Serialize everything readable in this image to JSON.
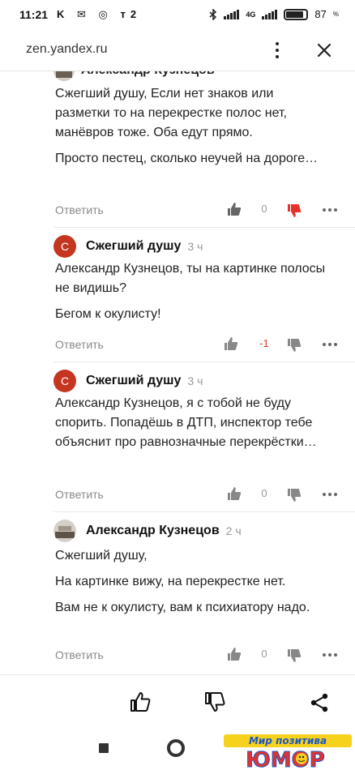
{
  "status_bar": {
    "time": "11:21",
    "left_icons": "K ✉ ◎ т2",
    "network": "4G",
    "battery_label": "87",
    "battery_percent": 87
  },
  "browser": {
    "url": "zen.yandex.ru"
  },
  "clipped_comment": {
    "author": "Александр Кузнецов",
    "paragraphs": [
      "Сжегший душу, Если нет знаков или разметки то на перекрестке полос нет, манёвров тоже. Оба едут прямо.",
      "Просто пестец, сколько неучей на дороге…"
    ],
    "reply_label": "Ответить",
    "score": "0",
    "user_vote": "dislike"
  },
  "comments": [
    {
      "avatar_letter": "С",
      "author": "Сжегший душу",
      "time": "3 ч",
      "paragraphs": [
        "Александр Кузнецов, ты на картинке полосы не видишь?",
        "Бегом к окулисту!"
      ],
      "reply_label": "Ответить",
      "score": "-1"
    },
    {
      "avatar_letter": "С",
      "author": "Сжегший душу",
      "time": "3 ч",
      "paragraphs": [
        "Александр Кузнецов, я с тобой не буду спорить. Попадёшь в ДТП, инспектор тебе объяснит про равнозначные перекрёстки…"
      ],
      "reply_label": "Ответить",
      "score": "0"
    },
    {
      "author": "Александр Кузнецов",
      "time": "2 ч",
      "paragraphs": [
        "Сжегший душу,",
        "На картинке вижу, на перекрестке нет.",
        "Вам не к окулисту, вам к психиатору надо."
      ],
      "reply_label": "Ответить",
      "score": "0"
    }
  ],
  "colors": {
    "accent_red": "#e5322d",
    "avatar_red": "#c4361f",
    "muted": "#8a8a8a"
  },
  "watermark": {
    "top_text": "Мир позитива",
    "main_text": "ЮМОР"
  }
}
